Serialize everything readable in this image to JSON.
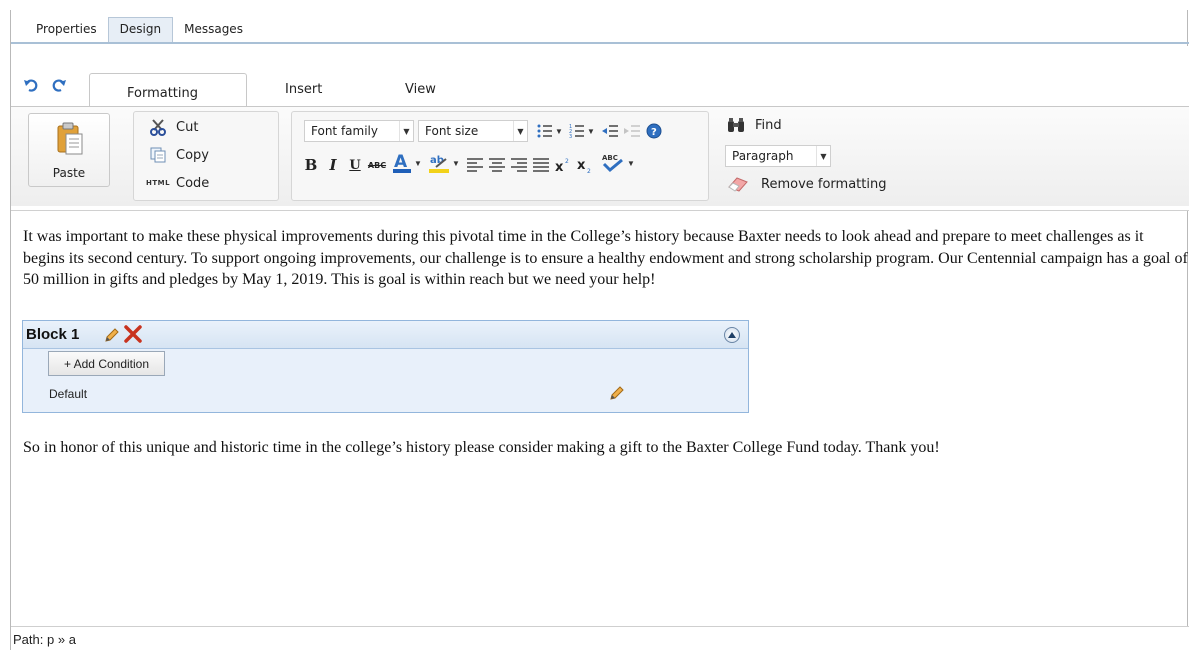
{
  "top_tabs": [
    {
      "label": "Properties",
      "active": false
    },
    {
      "label": "Design",
      "active": true
    },
    {
      "label": "Messages",
      "active": false
    }
  ],
  "ribbon_tabs": [
    {
      "label": "Formatting",
      "active": true
    },
    {
      "label": "Insert",
      "active": false
    },
    {
      "label": "View",
      "active": false
    }
  ],
  "clipboard": {
    "paste_label": "Paste",
    "cut_label": "Cut",
    "copy_label": "Copy",
    "code_label": "Code",
    "code_icon_text": "HTML"
  },
  "font": {
    "family_placeholder": "Font family",
    "size_placeholder": "Font size",
    "format_bold": "B",
    "format_italic": "I",
    "format_underline": "U",
    "format_strike": "ABC"
  },
  "tools": {
    "find_label": "Find",
    "paragraph_value": "Paragraph",
    "remove_formatting_label": "Remove formatting"
  },
  "editor": {
    "paragraph_1": "It was important to make these physical improvements during this pivotal time in the College’s history because Baxter needs to look ahead and prepare to meet challenges as it begins its second century. To support ongoing improvements, our challenge is to ensure a healthy endowment and strong scholarship program. Our Centennial campaign has a goal of 50 million in gifts and pledges by May 1, 2019. This is goal is within reach but we need your help!",
    "block": {
      "title": "Block 1",
      "add_condition_label": "+ Add Condition",
      "default_label": "Default"
    },
    "paragraph_2": "So in honor of this unique and historic time in the college’s history please consider making a gift to the Baxter College Fund today. Thank you!"
  },
  "status": {
    "path_prefix": "Path:",
    "path_p": "p",
    "separator": "»",
    "path_a": "a"
  },
  "colors": {
    "accent_blue": "#2f6fc0",
    "delete_red": "#c8331f",
    "block_bg": "#e8f0fa",
    "block_border": "#93b6dc"
  }
}
